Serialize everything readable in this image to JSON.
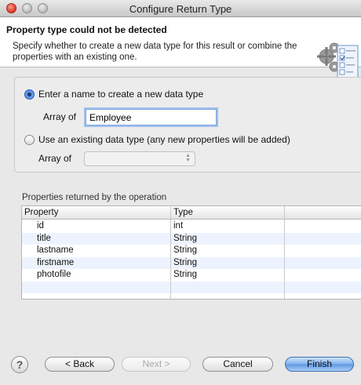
{
  "window": {
    "title": "Configure Return Type"
  },
  "banner": {
    "title": "Property type could not be detected",
    "description": "Specify whether to create a new data type for this result or combine the properties with an existing one.",
    "icon": "wizard-gears-icon"
  },
  "options": {
    "new_type": {
      "label": "Enter a name to create a new data type",
      "selected": true,
      "array_of_label": "Array of",
      "value": "Employee"
    },
    "existing_type": {
      "label": "Use an existing data type (any new properties will be added)",
      "selected": false,
      "array_of_label": "Array of",
      "value": ""
    }
  },
  "properties": {
    "section_label": "Properties returned by the operation",
    "columns": [
      "Property",
      "Type"
    ],
    "rows": [
      {
        "property": "id",
        "type": "int"
      },
      {
        "property": "title",
        "type": "String"
      },
      {
        "property": "lastname",
        "type": "String"
      },
      {
        "property": "firstname",
        "type": "String"
      },
      {
        "property": "photofile",
        "type": "String"
      }
    ]
  },
  "buttons": {
    "help": "?",
    "back": "< Back",
    "next": "Next >",
    "cancel": "Cancel",
    "finish": "Finish"
  },
  "colors": {
    "accent": "#3a78d8",
    "row_alt": "#edf3fe"
  }
}
